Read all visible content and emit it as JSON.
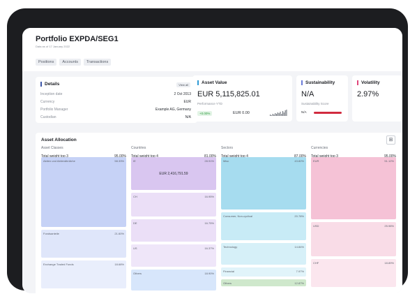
{
  "header": {
    "title": "Portfolio EXPDA/SEG1",
    "subtitle": "Data as of 17 January 2022",
    "tabs": [
      "Positions",
      "Accounts",
      "Transactions"
    ]
  },
  "details": {
    "title": "Details",
    "view_all": "View all",
    "rows": [
      {
        "label": "Inception date",
        "value": "2 Oct 2013"
      },
      {
        "label": "Currency",
        "value": "EUR"
      },
      {
        "label": "Portfolio Manager",
        "value": "Example AG, Germany"
      },
      {
        "label": "Custodian",
        "value": "N/A"
      }
    ]
  },
  "asset_value": {
    "title": "Asset Value",
    "value": "EUR 5,115,825.01",
    "perf_label": "Performance YTD",
    "perf_pct": "+0.00%",
    "perf_amount": "EUR 0.00",
    "sparkline": [
      2,
      1,
      3,
      2,
      4,
      3,
      5,
      4,
      6,
      3,
      7,
      5,
      8,
      9
    ]
  },
  "sustainability": {
    "title": "Sustainability",
    "value": "N/A",
    "score_label": "Sustainability Score",
    "score_value": "N/A"
  },
  "volatility": {
    "title": "Volatility",
    "value": "2.97%"
  },
  "allocation": {
    "title": "Asset Allocation",
    "columns": [
      {
        "head": "Asset Classes",
        "sub": "Total weight top 3",
        "total": "95.00%",
        "tiles": [
          {
            "label": "Aktien und Aktienähnliche",
            "pct": "58.33%",
            "color": "#c6d2f6",
            "value": ""
          },
          {
            "label": "Fondsanteile",
            "pct": "21.60%",
            "color": "#dfe6fa",
            "value": ""
          },
          {
            "label": "Exchange Traded Funds",
            "pct": "18.68%",
            "color": "#e9eefc",
            "value": ""
          }
        ]
      },
      {
        "head": "Countries",
        "sub": "Total weight top 4",
        "total": "81.00%",
        "tiles": [
          {
            "label": "IE",
            "pct": "28.91%",
            "color": "#d9c6f0",
            "value": "EUR 2,416,791.59"
          },
          {
            "label": "CH",
            "pct": "16.95%",
            "color": "#ebdff7",
            "value": ""
          },
          {
            "label": "DE",
            "pct": "16.75%",
            "color": "#ebdff7",
            "value": ""
          },
          {
            "label": "US",
            "pct": "16.37%",
            "color": "#efe6f9",
            "value": ""
          },
          {
            "label": "Others",
            "pct": "18.90%",
            "color": "#d7e6fb",
            "value": ""
          }
        ]
      },
      {
        "head": "Sectors",
        "sub": "Total weight top 4",
        "total": "87.00%",
        "tiles": [
          {
            "label": "Misc",
            "pct": "43.82%",
            "color": "#a6dcef",
            "value": ""
          },
          {
            "label": "Consumer, Non-cyclical",
            "pct": "20.78%",
            "color": "#c8ebf6",
            "value": ""
          },
          {
            "label": "Technology",
            "pct": "14.84%",
            "color": "#d6f0f8",
            "value": ""
          },
          {
            "label": "Financial",
            "pct": "7.97%",
            "color": "#e1f4fa",
            "value": ""
          },
          {
            "label": "Others",
            "pct": "12.87%",
            "color": "#cfe8cc",
            "value": ""
          }
        ]
      },
      {
        "head": "Currencies",
        "sub": "Total weight top 3",
        "total": "95.00%",
        "tiles": [
          {
            "label": "EUR",
            "pct": "51.12%",
            "color": "#f5c2d6",
            "value": ""
          },
          {
            "label": "USD",
            "pct": "25.98%",
            "color": "#f9dce7",
            "value": ""
          },
          {
            "label": "CHF",
            "pct": "18.89%",
            "color": "#fbe6ee",
            "value": ""
          }
        ]
      }
    ]
  },
  "colors": {
    "details_accent": "#3c56a8",
    "asset_accent": "#2f9bd6",
    "sustainability_accent": "#6b7bd8",
    "volatility_accent": "#e0457b",
    "score_bar": "#d12b3f"
  },
  "icons": {
    "sparkline": "bar-chart-icon",
    "grid": "grid-icon"
  }
}
